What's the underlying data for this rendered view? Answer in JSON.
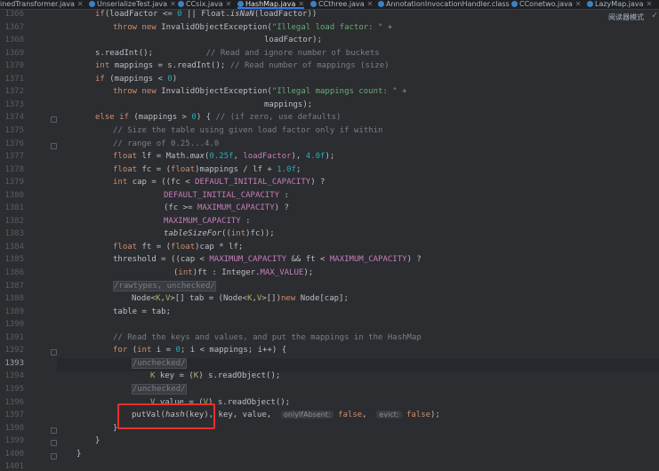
{
  "tabs": [
    {
      "label": "inedTransformer.java",
      "active": false
    },
    {
      "label": "UnserializeTest.java",
      "active": false
    },
    {
      "label": "CCsix.java",
      "active": false
    },
    {
      "label": "HashMap.java",
      "active": true
    },
    {
      "label": "CCthree.java",
      "active": false
    },
    {
      "label": "AnnotationInvocationHandler.class",
      "active": false
    },
    {
      "label": "CConetwo.java",
      "active": false
    },
    {
      "label": "LazyMap.java",
      "active": false
    }
  ],
  "reader_mode_label": "阅读器模式",
  "icons": {
    "tab_file": "java-class-icon",
    "tab_close": "close-icon",
    "check": "check-icon",
    "fold": "fold-marker-icon"
  },
  "colors": {
    "background": "#2b2d30",
    "keyword": "#cf8e6d",
    "string": "#6aab73",
    "number": "#2aacb8",
    "comment": "#7a7e85",
    "constant": "#c77dbb",
    "highlight_box": "#e8302c"
  },
  "current_line": "1393",
  "line_numbers": [
    "1366",
    "1367",
    "1368",
    "1369",
    "1370",
    "1371",
    "1372",
    "1373",
    "1374",
    "1375",
    "1376",
    "1377",
    "1378",
    "1379",
    "1380",
    "1381",
    "1382",
    "1383",
    "1384",
    "1385",
    "1386",
    "1387",
    "1388",
    "1389",
    "1390",
    "1391",
    "1392",
    "1393",
    "1394",
    "1395",
    "1396",
    "1397",
    "1398",
    "1399",
    "1400",
    "1401"
  ],
  "code": {
    "l1366": [
      [
        "k",
        "if"
      ],
      [
        "",
        "("
      ],
      [
        "",
        "loadFactor"
      ],
      [
        "",
        " <= "
      ],
      [
        "n",
        "0"
      ],
      [
        "",
        " || Float."
      ],
      [
        "it",
        "isNaN"
      ],
      [
        "",
        "(loadFactor))"
      ]
    ],
    "l1367": [
      [
        "k",
        "throw new "
      ],
      [
        "",
        "InvalidObjectException("
      ],
      [
        "s",
        "\"Illegal load factor: \" +"
      ]
    ],
    "l1368": [
      [
        "",
        "loadFactor);"
      ]
    ],
    "l1369": [
      [
        "",
        "s.readInt();"
      ],
      [
        "c",
        "           // Read and ignore number of buckets"
      ]
    ],
    "l1370": [
      [
        "k",
        "int "
      ],
      [
        "",
        "mappings = s.readInt(); "
      ],
      [
        "c",
        "// Read number of mappings (size)"
      ]
    ],
    "l1371": [
      [
        "k",
        "if "
      ],
      [
        "",
        "(mappings < "
      ],
      [
        "n",
        "0"
      ],
      [
        "",
        ")"
      ]
    ],
    "l1372": [
      [
        "k",
        "throw new "
      ],
      [
        "",
        "InvalidObjectException("
      ],
      [
        "s",
        "\"Illegal mappings count: \" +"
      ]
    ],
    "l1373": [
      [
        "",
        "mappings);"
      ]
    ],
    "l1374": [
      [
        "k",
        "else if "
      ],
      [
        "",
        "(mappings > "
      ],
      [
        "n",
        "0"
      ],
      [
        "",
        ") { "
      ],
      [
        "c",
        "// (if zero, use defaults)"
      ]
    ],
    "l1375": [
      [
        "c",
        "// Size the table using given load factor only if within"
      ]
    ],
    "l1376": [
      [
        "c",
        "// range of 0.25...4.0"
      ]
    ],
    "l1377": [
      [
        "k",
        "float "
      ],
      [
        "",
        "lf = Math."
      ],
      [
        "it",
        "max"
      ],
      [
        "",
        "("
      ],
      [
        "n",
        "0.25f"
      ],
      [
        "",
        ", "
      ],
      [
        "f",
        "loadFactor"
      ],
      [
        "",
        "), "
      ],
      [
        "n",
        "4.0f"
      ],
      [
        "",
        ");"
      ]
    ],
    "l1378": [
      [
        "k",
        "float "
      ],
      [
        "",
        "fc = ("
      ],
      [
        "k",
        "float"
      ],
      [
        "",
        ")mappings / lf + "
      ],
      [
        "n",
        "1.0f"
      ],
      [
        "",
        ";"
      ]
    ],
    "l1379": [
      [
        "k",
        "int "
      ],
      [
        "",
        "cap = ((fc < "
      ],
      [
        "f",
        "DEFAULT_INITIAL_CAPACITY"
      ],
      [
        "",
        ") ?"
      ]
    ],
    "l1380": [
      [
        "f",
        "DEFAULT_INITIAL_CAPACITY"
      ],
      [
        "",
        " :"
      ]
    ],
    "l1381": [
      [
        "",
        "(fc >= "
      ],
      [
        "f",
        "MAXIMUM_CAPACITY"
      ],
      [
        "",
        ") ?"
      ]
    ],
    "l1382": [
      [
        "f",
        "MAXIMUM_CAPACITY"
      ],
      [
        "",
        " :"
      ]
    ],
    "l1383": [
      [
        "it",
        "tableSizeFor"
      ],
      [
        "",
        "(("
      ],
      [
        "k",
        "int"
      ],
      [
        "",
        ")fc));"
      ]
    ],
    "l1384": [
      [
        "k",
        "float "
      ],
      [
        "",
        "ft = ("
      ],
      [
        "k",
        "float"
      ],
      [
        "",
        ")cap * lf;"
      ]
    ],
    "l1385": [
      [
        "",
        "threshold = ((cap < "
      ],
      [
        "f",
        "MAXIMUM_CAPACITY"
      ],
      [
        "",
        " && ft < "
      ],
      [
        "f",
        "MAXIMUM_CAPACITY"
      ],
      [
        "",
        ") ?"
      ]
    ],
    "l1386": [
      [
        "",
        "("
      ],
      [
        "k",
        "int"
      ],
      [
        "",
        ")ft : Integer."
      ],
      [
        "f",
        "MAX_VALUE"
      ],
      [
        "",
        ");"
      ]
    ],
    "l1387": [
      [
        "ann",
        "/rawtypes, unchecked/"
      ]
    ],
    "l1388": [
      [
        "",
        "Node<"
      ],
      [
        "gen",
        "K"
      ],
      [
        "",
        ","
      ],
      [
        "gen",
        "V"
      ],
      [
        "",
        ">[] tab = (Node<"
      ],
      [
        "gen",
        "K"
      ],
      [
        "",
        ","
      ],
      [
        "gen",
        "V"
      ],
      [
        "",
        ">[])"
      ],
      [
        "k",
        "new "
      ],
      [
        "",
        "Node[cap];"
      ]
    ],
    "l1389": [
      [
        "",
        "table = tab;"
      ]
    ],
    "l1390": [],
    "l1391": [
      [
        "c",
        "// Read the keys and values, and put the mappings in the HashMap"
      ]
    ],
    "l1392": [
      [
        "k",
        "for "
      ],
      [
        "",
        "("
      ],
      [
        "k",
        "int "
      ],
      [
        "",
        "i = "
      ],
      [
        "n",
        "0"
      ],
      [
        "",
        "; i < mappings; i++) {"
      ]
    ],
    "l1393": [
      [
        "ann",
        "/unchecked/"
      ]
    ],
    "l1394": [
      [
        "gen",
        "K"
      ],
      [
        "",
        " key = ("
      ],
      [
        "gen",
        "K"
      ],
      [
        "",
        ") s.readObject();"
      ]
    ],
    "l1395": [
      [
        "ann",
        "/unchecked/"
      ]
    ],
    "l1396": [
      [
        "gen",
        "V"
      ],
      [
        "",
        " value = ("
      ],
      [
        "gen",
        "V"
      ],
      [
        "",
        ") s.readObject();"
      ]
    ],
    "l1397": [
      [
        "",
        "putVal("
      ],
      [
        "it",
        "hash"
      ],
      [
        "",
        "(key), key, value,  "
      ],
      [
        "hint",
        "onlyIfAbsent:"
      ],
      [
        "",
        " "
      ],
      [
        "k",
        "false"
      ],
      [
        "",
        ",  "
      ],
      [
        "hint",
        "evict:"
      ],
      [
        "",
        " "
      ],
      [
        "k",
        "false"
      ],
      [
        "",
        ");"
      ]
    ],
    "l1398": [
      [
        "",
        "}"
      ]
    ],
    "l1399": [
      [
        "",
        "}"
      ]
    ],
    "l1400": [
      [
        "",
        "}"
      ]
    ],
    "l1401": []
  }
}
